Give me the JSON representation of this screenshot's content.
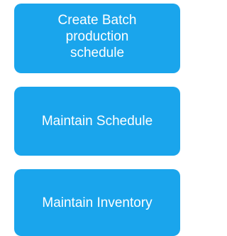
{
  "menu": {
    "items": [
      {
        "label": "Create  Batch\nproduction\nschedule"
      },
      {
        "label": "Maintain Schedule"
      },
      {
        "label": "Maintain Inventory"
      }
    ]
  },
  "colors": {
    "tile_background": "#1aa5ec",
    "tile_text": "#ffffff",
    "page_background": "#ffffff"
  }
}
